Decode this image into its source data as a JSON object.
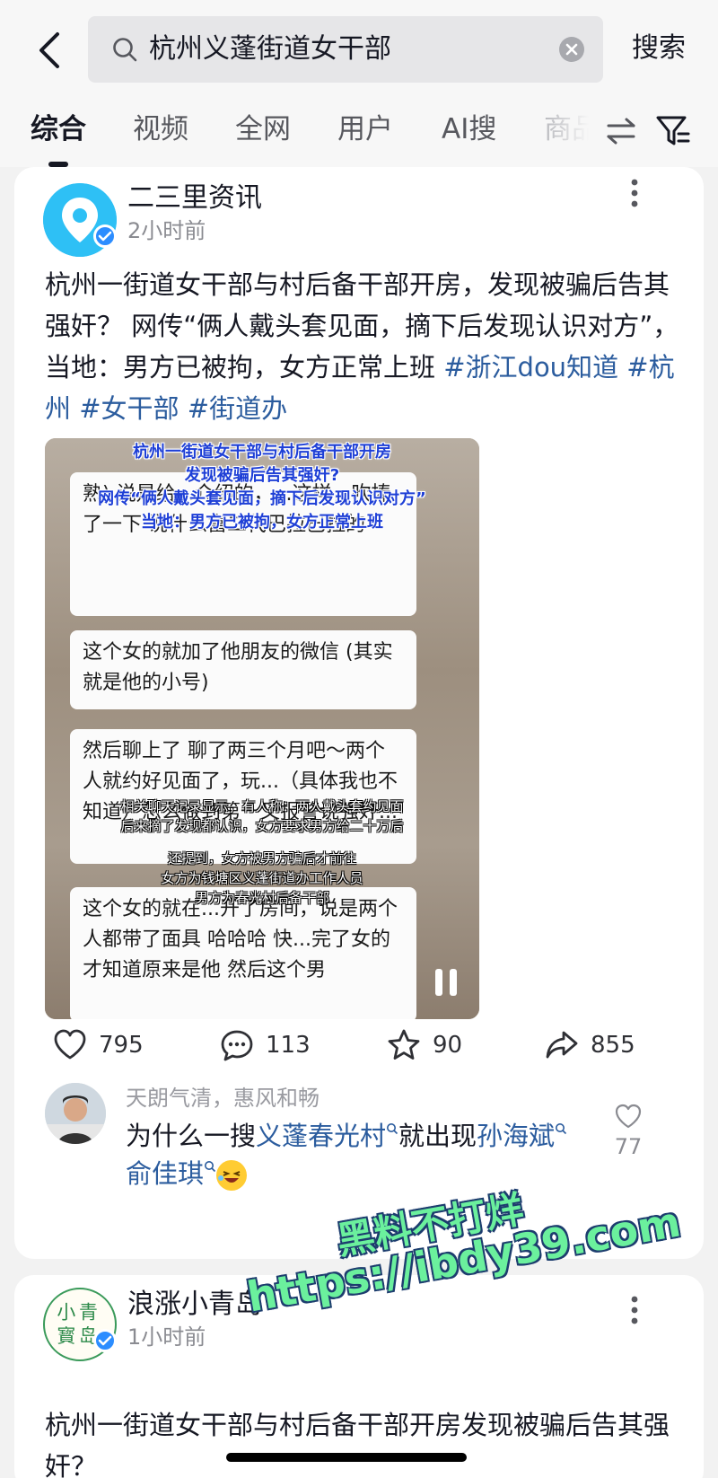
{
  "search": {
    "query": "杭州义蓬街道女干部",
    "submit_label": "搜索"
  },
  "tabs": [
    "综合",
    "视频",
    "全网",
    "用户",
    "AI搜",
    "商品"
  ],
  "post1": {
    "author": "二三里资讯",
    "time": "2小时前",
    "text": "杭州一街道女干部与村后备干部开房，发现被骗后告其强奸？ 网传“俩人戴头套见面，摘下后发现认识对方”，当地：男方已被拘，女方正常上班 ",
    "hashtags": [
      "#浙江dou知道",
      "#杭州",
      "#女干部",
      "#街道办"
    ],
    "video": {
      "caption_blue": [
        "杭州一街道女干部与村后备干部开房",
        "发现被骗后告其强奸?",
        "网传“俩人戴头套见面，摘下后发现认识对方”",
        "当地：男方已被拘，女方正常上班"
      ],
      "bubbles": [
        "熟) 说是给...介绍的，...这样，吹捧了一下 说什么富二代巴拉巴拉的",
        "这个女的就加了他朋友的微信 (其实就是他的小号)",
        "然后聊上了 聊了两三个月吧～两个人就约好见面了，玩...（具体我也不知道）怎么做到第一又报警说强奸...",
        "这个女的就在...开了房间，说是两个人都带了面具 哈哈哈 快...完了女的才知道原来是他 然后这个男"
      ],
      "caption_white": [
        "相关聊天记录显示，有人称：两人戴头套约见面",
        "后来摘了发现都认识，女方要求男方给二十万后",
        "还提到，女方被男方骗后才前往",
        "女方为钱塘区义蓬街道办工作人员",
        "男方为春光村后备干部"
      ]
    },
    "actions": {
      "likes": "795",
      "comments": "113",
      "favorites": "90",
      "shares": "855"
    },
    "comment": {
      "user": "天朗气清，惠风和畅",
      "text_before": "为什么一搜",
      "link1": "义蓬春光村",
      "text_middle": "就出现",
      "link2": "孙海斌",
      "link3": "俞佳琪",
      "likes": "77"
    }
  },
  "post2": {
    "author": "浪涨小青岛",
    "avatar_text": "小青\n岛",
    "time": "1小时前",
    "text": "杭州一街道女干部与村后备干部开房发现被骗后告其强奸？"
  },
  "watermark": {
    "line1": "黑料不打烊",
    "line2": "https://ibdy39.com"
  },
  "colors": {
    "hashtag": "#2b5c9e",
    "verified": "#2c8dff",
    "watermark": "#6bf09d"
  }
}
